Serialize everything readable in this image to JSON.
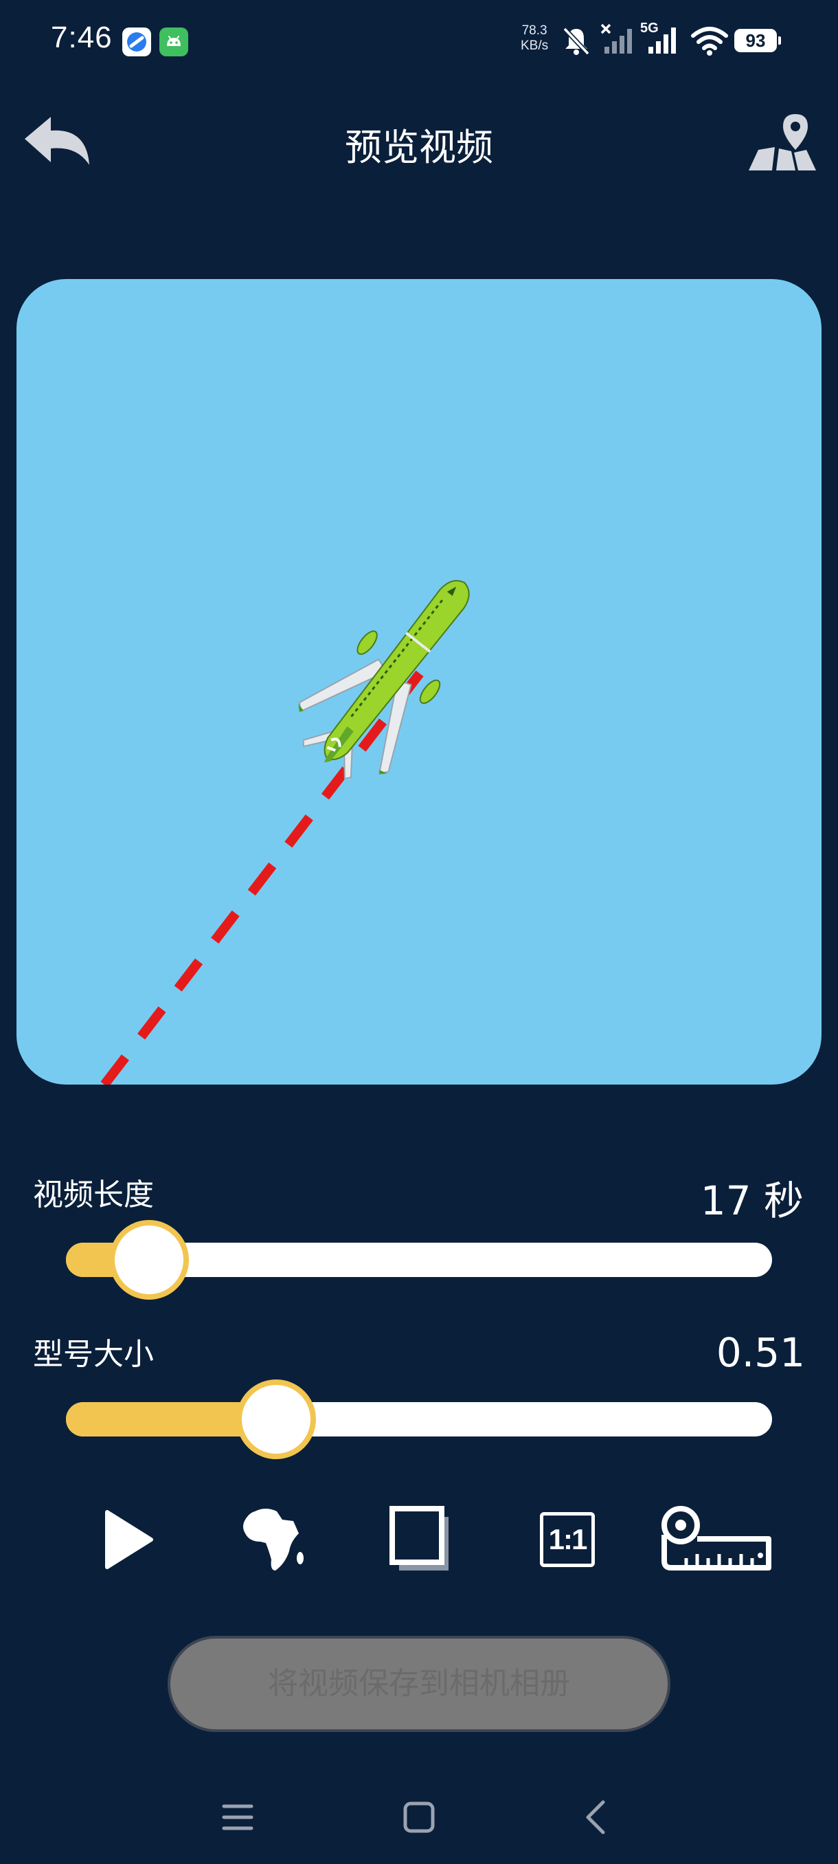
{
  "status_bar": {
    "time": "7:46",
    "network_speed_value": "78.3",
    "network_speed_unit": "KB/s",
    "network_type": "5G",
    "battery": "93"
  },
  "header": {
    "title": "预览视频",
    "back_icon": "back-arrow-icon",
    "map_icon": "map-pin-icon"
  },
  "controls": {
    "video_length": {
      "label": "视频长度",
      "value": "17 秒",
      "fraction": 0.11
    },
    "model_size": {
      "label": "型号大小",
      "value": "0.51",
      "fraction": 0.29
    }
  },
  "toolbar": {
    "icons": [
      "play-icon",
      "africa-map-icon",
      "frame-icon",
      "aspect-ratio-icon",
      "ruler-icon"
    ],
    "aspect_label": "1:1"
  },
  "save_button": {
    "label": "将视频保存到相机相册"
  },
  "colors": {
    "background": "#0a1f3a",
    "preview_sky": "#77cbf1",
    "accent": "#f2c550",
    "path": "#e51b1b",
    "plane": "#9bd42a"
  }
}
